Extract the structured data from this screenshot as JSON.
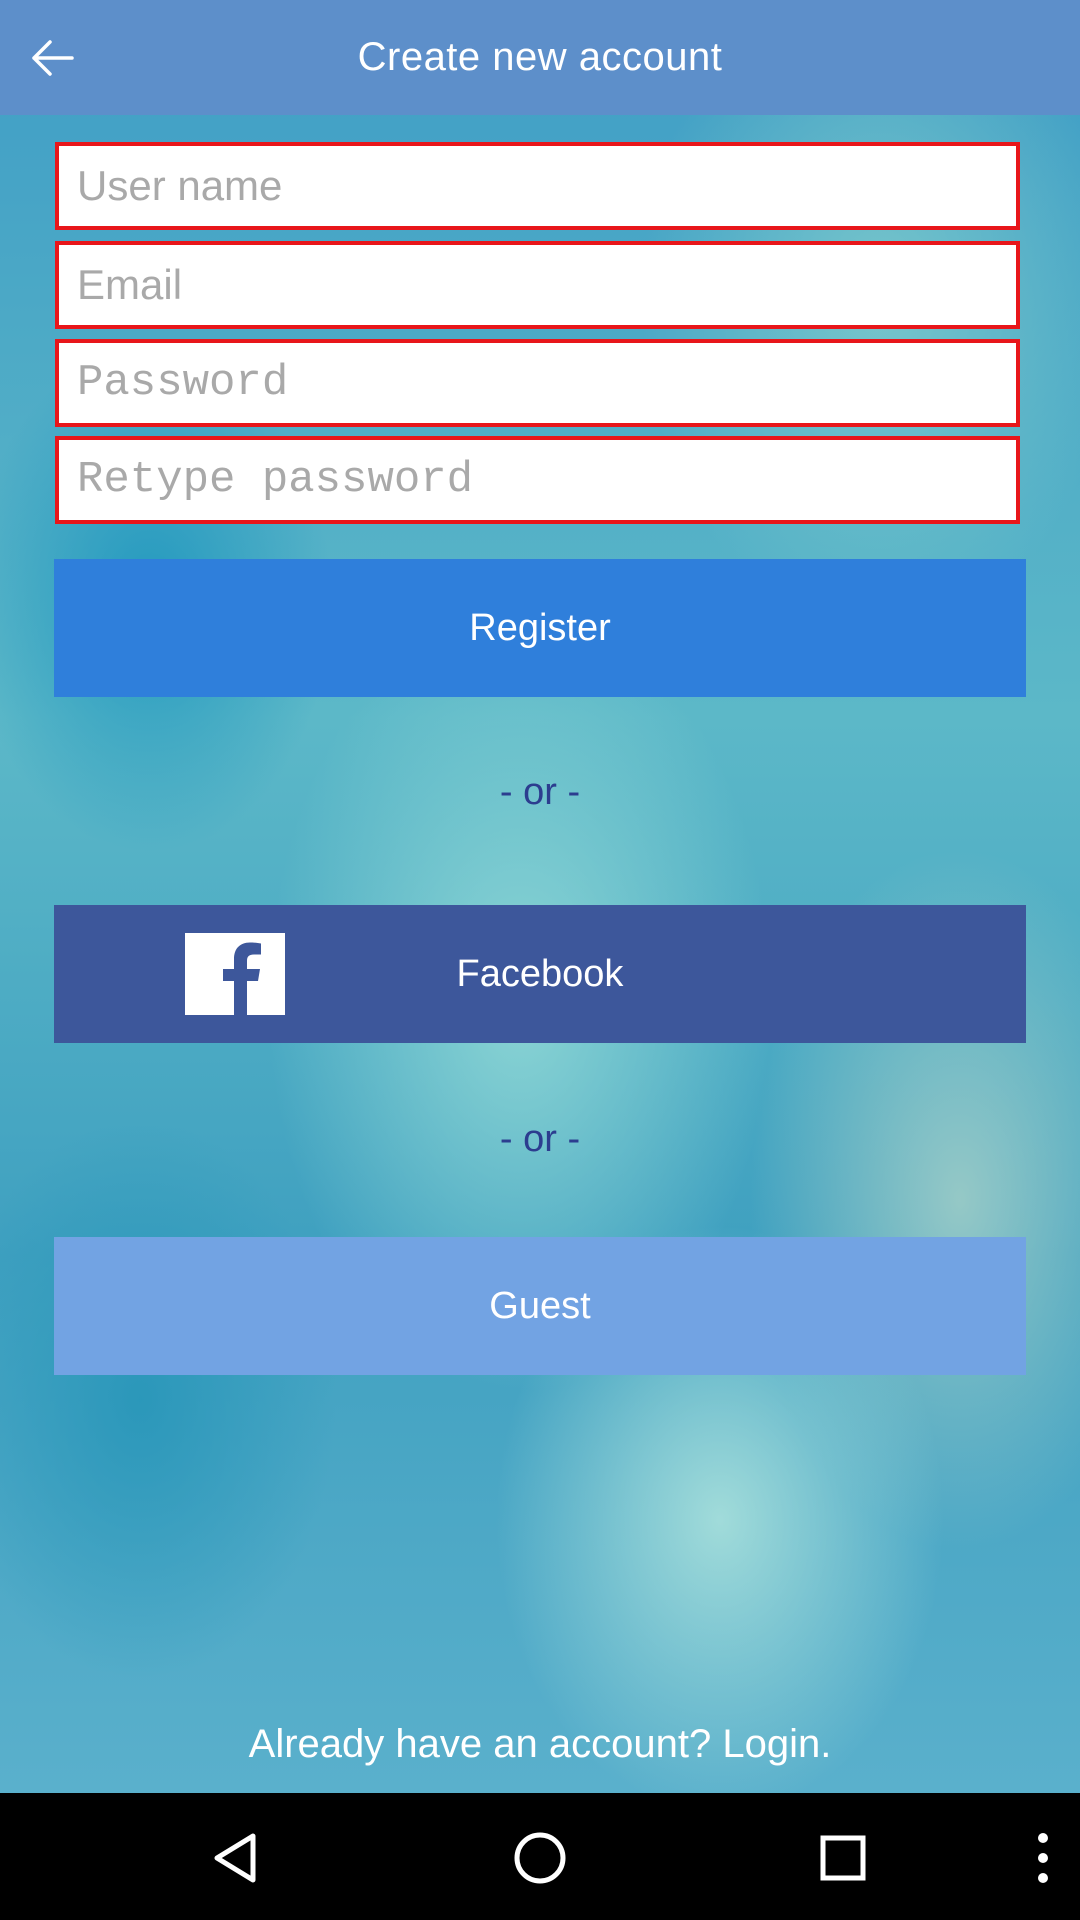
{
  "header": {
    "title": "Create new account",
    "back_icon": "arrow-left-icon"
  },
  "form": {
    "username_placeholder": "User name",
    "email_placeholder": "Email",
    "password_placeholder": "Password",
    "retype_password_placeholder": "Retype password",
    "field_border_color": "#e8161a"
  },
  "buttons": {
    "register_label": "Register",
    "facebook_label": "Facebook",
    "guest_label": "Guest",
    "register_color": "#2f7fdb",
    "facebook_color": "#3d579b",
    "guest_color": "#72a3e3"
  },
  "separators": {
    "first": "- or -",
    "second": "- or -"
  },
  "footer": {
    "login_link": "Already have an account? Login."
  },
  "nav": {
    "back": "triangle-back-icon",
    "home": "circle-home-icon",
    "recents": "square-recents-icon",
    "menu": "vertical-dots-icon"
  }
}
